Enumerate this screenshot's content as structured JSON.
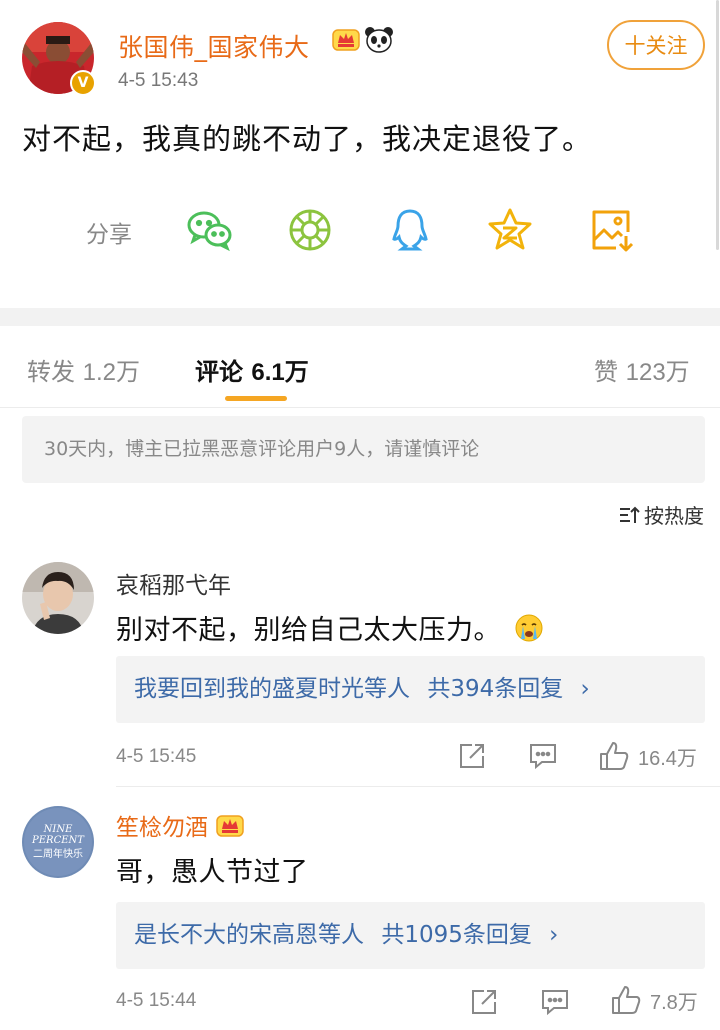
{
  "post": {
    "author": "张国伟_国家伟大",
    "time": "4-5 15:43",
    "follow_label": "十关注",
    "text": "对不起，我真的跳不动了，我决定退役了。",
    "share_label": "分享",
    "share_targets": [
      "wechat-icon",
      "moments-icon",
      "qq-icon",
      "qzone-icon",
      "save-image-icon"
    ],
    "verified_badge": "V"
  },
  "tabs": {
    "repost": {
      "label": "转发",
      "count": "1.2万"
    },
    "comment": {
      "label": "评论",
      "count": "6.1万"
    },
    "like": {
      "label": "赞",
      "count": "123万"
    }
  },
  "notice": "30天内，博主已拉黑恶意评论用户9人，请谨慎评论",
  "sort_label": "按热度",
  "comments": [
    {
      "user": "哀稻那弋年",
      "text": "别对不起，别给自己太大压力。",
      "emoji": "crying-face",
      "reply_names": "我要回到我的盛夏时光等人",
      "reply_count": "共394条回复",
      "time": "4-5 15:45",
      "likes": "16.4万"
    },
    {
      "user": "笙棯勿酒",
      "text": "哥，愚人节过了",
      "reply_names": "是长不大的宋高恩等人",
      "reply_count": "共1095条回复",
      "time": "4-5 15:44",
      "likes": "7.8万",
      "avatar_text": [
        "NINE",
        "PERCENT",
        "二周年快乐"
      ]
    }
  ],
  "colors": {
    "accent": "#f5a623",
    "author_orange": "#e86a17",
    "link_blue": "#3d6aa8",
    "muted": "#888888"
  }
}
